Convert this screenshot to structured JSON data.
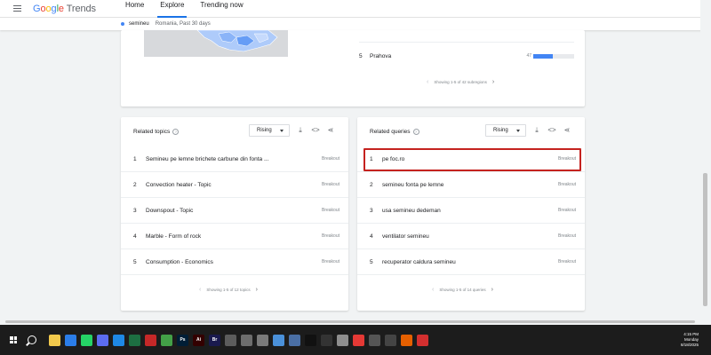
{
  "header": {
    "logo_google": [
      "G",
      "o",
      "o",
      "g",
      "l",
      "e"
    ],
    "logo_trends": "Trends",
    "nav": [
      {
        "label": "Home",
        "active": false
      },
      {
        "label": "Explore",
        "active": true
      },
      {
        "label": "Trending now",
        "active": false
      }
    ]
  },
  "subheader": {
    "term": "semineu",
    "meta": "Romania, Past 30 days"
  },
  "regions": {
    "row": {
      "rank": "5",
      "name": "Prahova",
      "value_label": "47",
      "value": 47
    },
    "pager_text": "Showing 1-5 of 42 subregions"
  },
  "related_topics": {
    "title": "Related topics",
    "filter": "Rising",
    "rows": [
      {
        "rank": "1",
        "label": "Semineu pe lemne brichete carbune din fonta ...",
        "value": "Breakout"
      },
      {
        "rank": "2",
        "label": "Convection heater - Topic",
        "value": "Breakout"
      },
      {
        "rank": "3",
        "label": "Downspout - Topic",
        "value": "Breakout"
      },
      {
        "rank": "4",
        "label": "Marble - Form of rock",
        "value": "Breakout"
      },
      {
        "rank": "5",
        "label": "Consumption - Economics",
        "value": "Breakout"
      }
    ],
    "pager_text": "Showing 1-5 of 12 topics"
  },
  "related_queries": {
    "title": "Related queries",
    "filter": "Rising",
    "rows": [
      {
        "rank": "1",
        "label": "pe foc.ro",
        "value": "Breakout"
      },
      {
        "rank": "2",
        "label": "semineu fonta pe lemne",
        "value": "Breakout"
      },
      {
        "rank": "3",
        "label": "usa semineu dedeman",
        "value": "Breakout"
      },
      {
        "rank": "4",
        "label": "ventilator semineu",
        "value": "Breakout"
      },
      {
        "rank": "5",
        "label": "recuperator caldura semineu",
        "value": "Breakout"
      }
    ],
    "pager_text": "Showing 1-5 of 14 queries"
  },
  "icons": {
    "download": "download-icon",
    "embed": "embed-icon",
    "share": "share-icon",
    "help": "help-icon"
  },
  "colors": {
    "accent": "#1a73e8",
    "bar": "#4285f4",
    "highlight_box": "#c5221f"
  },
  "taskbar": {
    "apps": [
      {
        "name": "file-explorer-icon",
        "color": "#f2c94c",
        "glyph": ""
      },
      {
        "name": "chrome-icon",
        "color": "#2b7de9",
        "glyph": ""
      },
      {
        "name": "whatsapp-icon",
        "color": "#25d366",
        "glyph": ""
      },
      {
        "name": "chat-app-icon",
        "color": "#5b6cf0",
        "glyph": ""
      },
      {
        "name": "app-blue-icon",
        "color": "#1e88e5",
        "glyph": ""
      },
      {
        "name": "spreadsheet-icon",
        "color": "#1d6f42",
        "glyph": ""
      },
      {
        "name": "pdf-icon",
        "color": "#c62828",
        "glyph": ""
      },
      {
        "name": "leaf-app-icon",
        "color": "#43a047",
        "glyph": ""
      },
      {
        "name": "photoshop-icon",
        "color": "#001e36",
        "glyph": "Ps"
      },
      {
        "name": "illustrator-icon",
        "color": "#330000",
        "glyph": "Ai"
      },
      {
        "name": "bridge-icon",
        "color": "#1a1a4e",
        "glyph": "Br"
      },
      {
        "name": "notes-icon",
        "color": "#5c5c5c",
        "glyph": ""
      },
      {
        "name": "document-icon",
        "color": "#6d6d6d",
        "glyph": ""
      },
      {
        "name": "mail-icon",
        "color": "#7a7a7a",
        "glyph": ""
      },
      {
        "name": "image-viewer-icon",
        "color": "#4a90d9",
        "glyph": ""
      },
      {
        "name": "book-icon",
        "color": "#4a6fa5",
        "glyph": ""
      },
      {
        "name": "tiktok-icon",
        "color": "#111111",
        "glyph": ""
      },
      {
        "name": "bolt-app-icon",
        "color": "#333333",
        "glyph": ""
      },
      {
        "name": "paint-icon",
        "color": "#8e8e8e",
        "glyph": ""
      },
      {
        "name": "colorful-app-icon",
        "color": "#e53935",
        "glyph": ""
      },
      {
        "name": "settings-app-icon",
        "color": "#555555",
        "glyph": ""
      },
      {
        "name": "clock-app-icon",
        "color": "#444444",
        "glyph": ""
      },
      {
        "name": "firefox-icon",
        "color": "#e66000",
        "glyph": ""
      },
      {
        "name": "red-app-icon",
        "color": "#d32f2f",
        "glyph": ""
      }
    ],
    "time": "4:15 PM",
    "day": "Monday",
    "date": "8/18/2025"
  }
}
